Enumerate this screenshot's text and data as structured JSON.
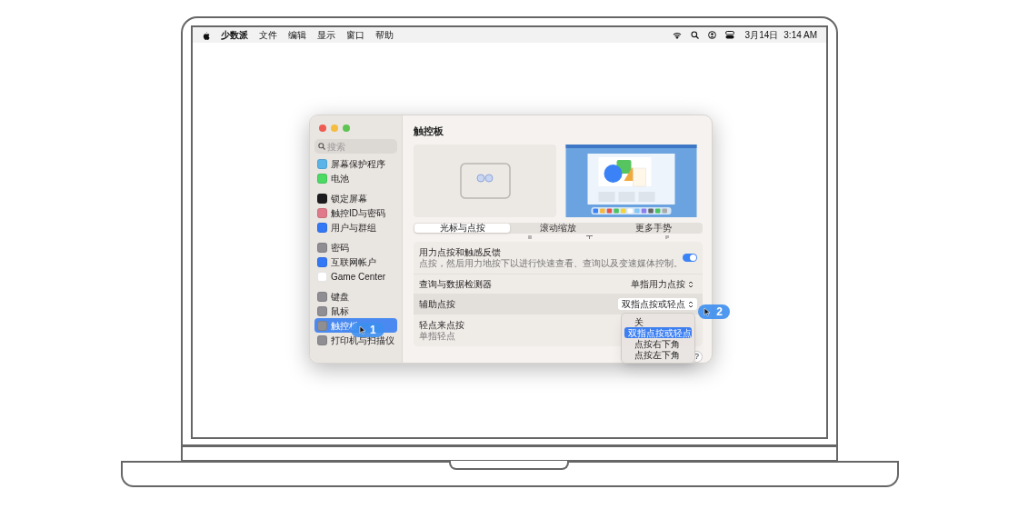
{
  "menu_bar": {
    "app": "少数派",
    "menus": [
      "文件",
      "编辑",
      "显示",
      "窗口",
      "帮助"
    ],
    "date": "3月14日",
    "time": "3:14 AM"
  },
  "sidebar": {
    "search": {
      "placeholder": "搜索"
    },
    "groups": [
      [
        {
          "label": "屏幕保护程序",
          "selected": false,
          "color": "#5ab4e8"
        },
        {
          "label": "电池",
          "selected": false,
          "color": "#4cd964"
        }
      ],
      [
        {
          "label": "锁定屏幕",
          "selected": false,
          "color": "#1c1c1e"
        },
        {
          "label": "触控ID与密码",
          "selected": false,
          "color": "#e07a8a"
        },
        {
          "label": "用户与群组",
          "selected": false,
          "color": "#3478f6"
        }
      ],
      [
        {
          "label": "密码",
          "selected": false,
          "color": "#8e8e93"
        },
        {
          "label": "互联网帐户",
          "selected": false,
          "color": "#3478f6"
        },
        {
          "label": "Game Center",
          "selected": false,
          "color": "#ffffff"
        }
      ],
      [
        {
          "label": "键盘",
          "selected": false,
          "color": "#8e8e93"
        },
        {
          "label": "鼠标",
          "selected": false,
          "color": "#8e8e93"
        },
        {
          "label": "触控板",
          "selected": true,
          "color": "#8e8e93"
        },
        {
          "label": "打印机与扫描仪",
          "selected": false,
          "color": "#8e8e93"
        }
      ]
    ]
  },
  "content": {
    "title": "触控板",
    "tabs": [
      {
        "label": "光标与点按",
        "selected": true
      },
      {
        "label": "滚动缩放",
        "selected": false
      },
      {
        "label": "更多手势",
        "selected": false
      }
    ],
    "rows": [
      {
        "kind": "toggle",
        "label": "用力点按和触感反馈",
        "description": "点按，然后用力地按下以进行快速查看、查询以及变速媒体控制。",
        "on": true,
        "highlighted": false
      },
      {
        "kind": "popup",
        "label": "查询与数据检测器",
        "value": "单指用力点按",
        "highlighted": false
      },
      {
        "kind": "popup",
        "label": "辅助点按",
        "value": "双指点按或轻点",
        "highlighted": true
      },
      {
        "kind": "covered",
        "label": "轻点来点按",
        "description": "单指轻点",
        "highlighted": false
      }
    ],
    "menu": [
      {
        "label": "关",
        "selected": false
      },
      {
        "label": "双指点按或轻点",
        "selected": true
      },
      {
        "label": "点按右下角",
        "selected": false
      },
      {
        "label": "点按左下角",
        "selected": false
      }
    ],
    "help": "?"
  },
  "badges": [
    "1",
    "2"
  ]
}
